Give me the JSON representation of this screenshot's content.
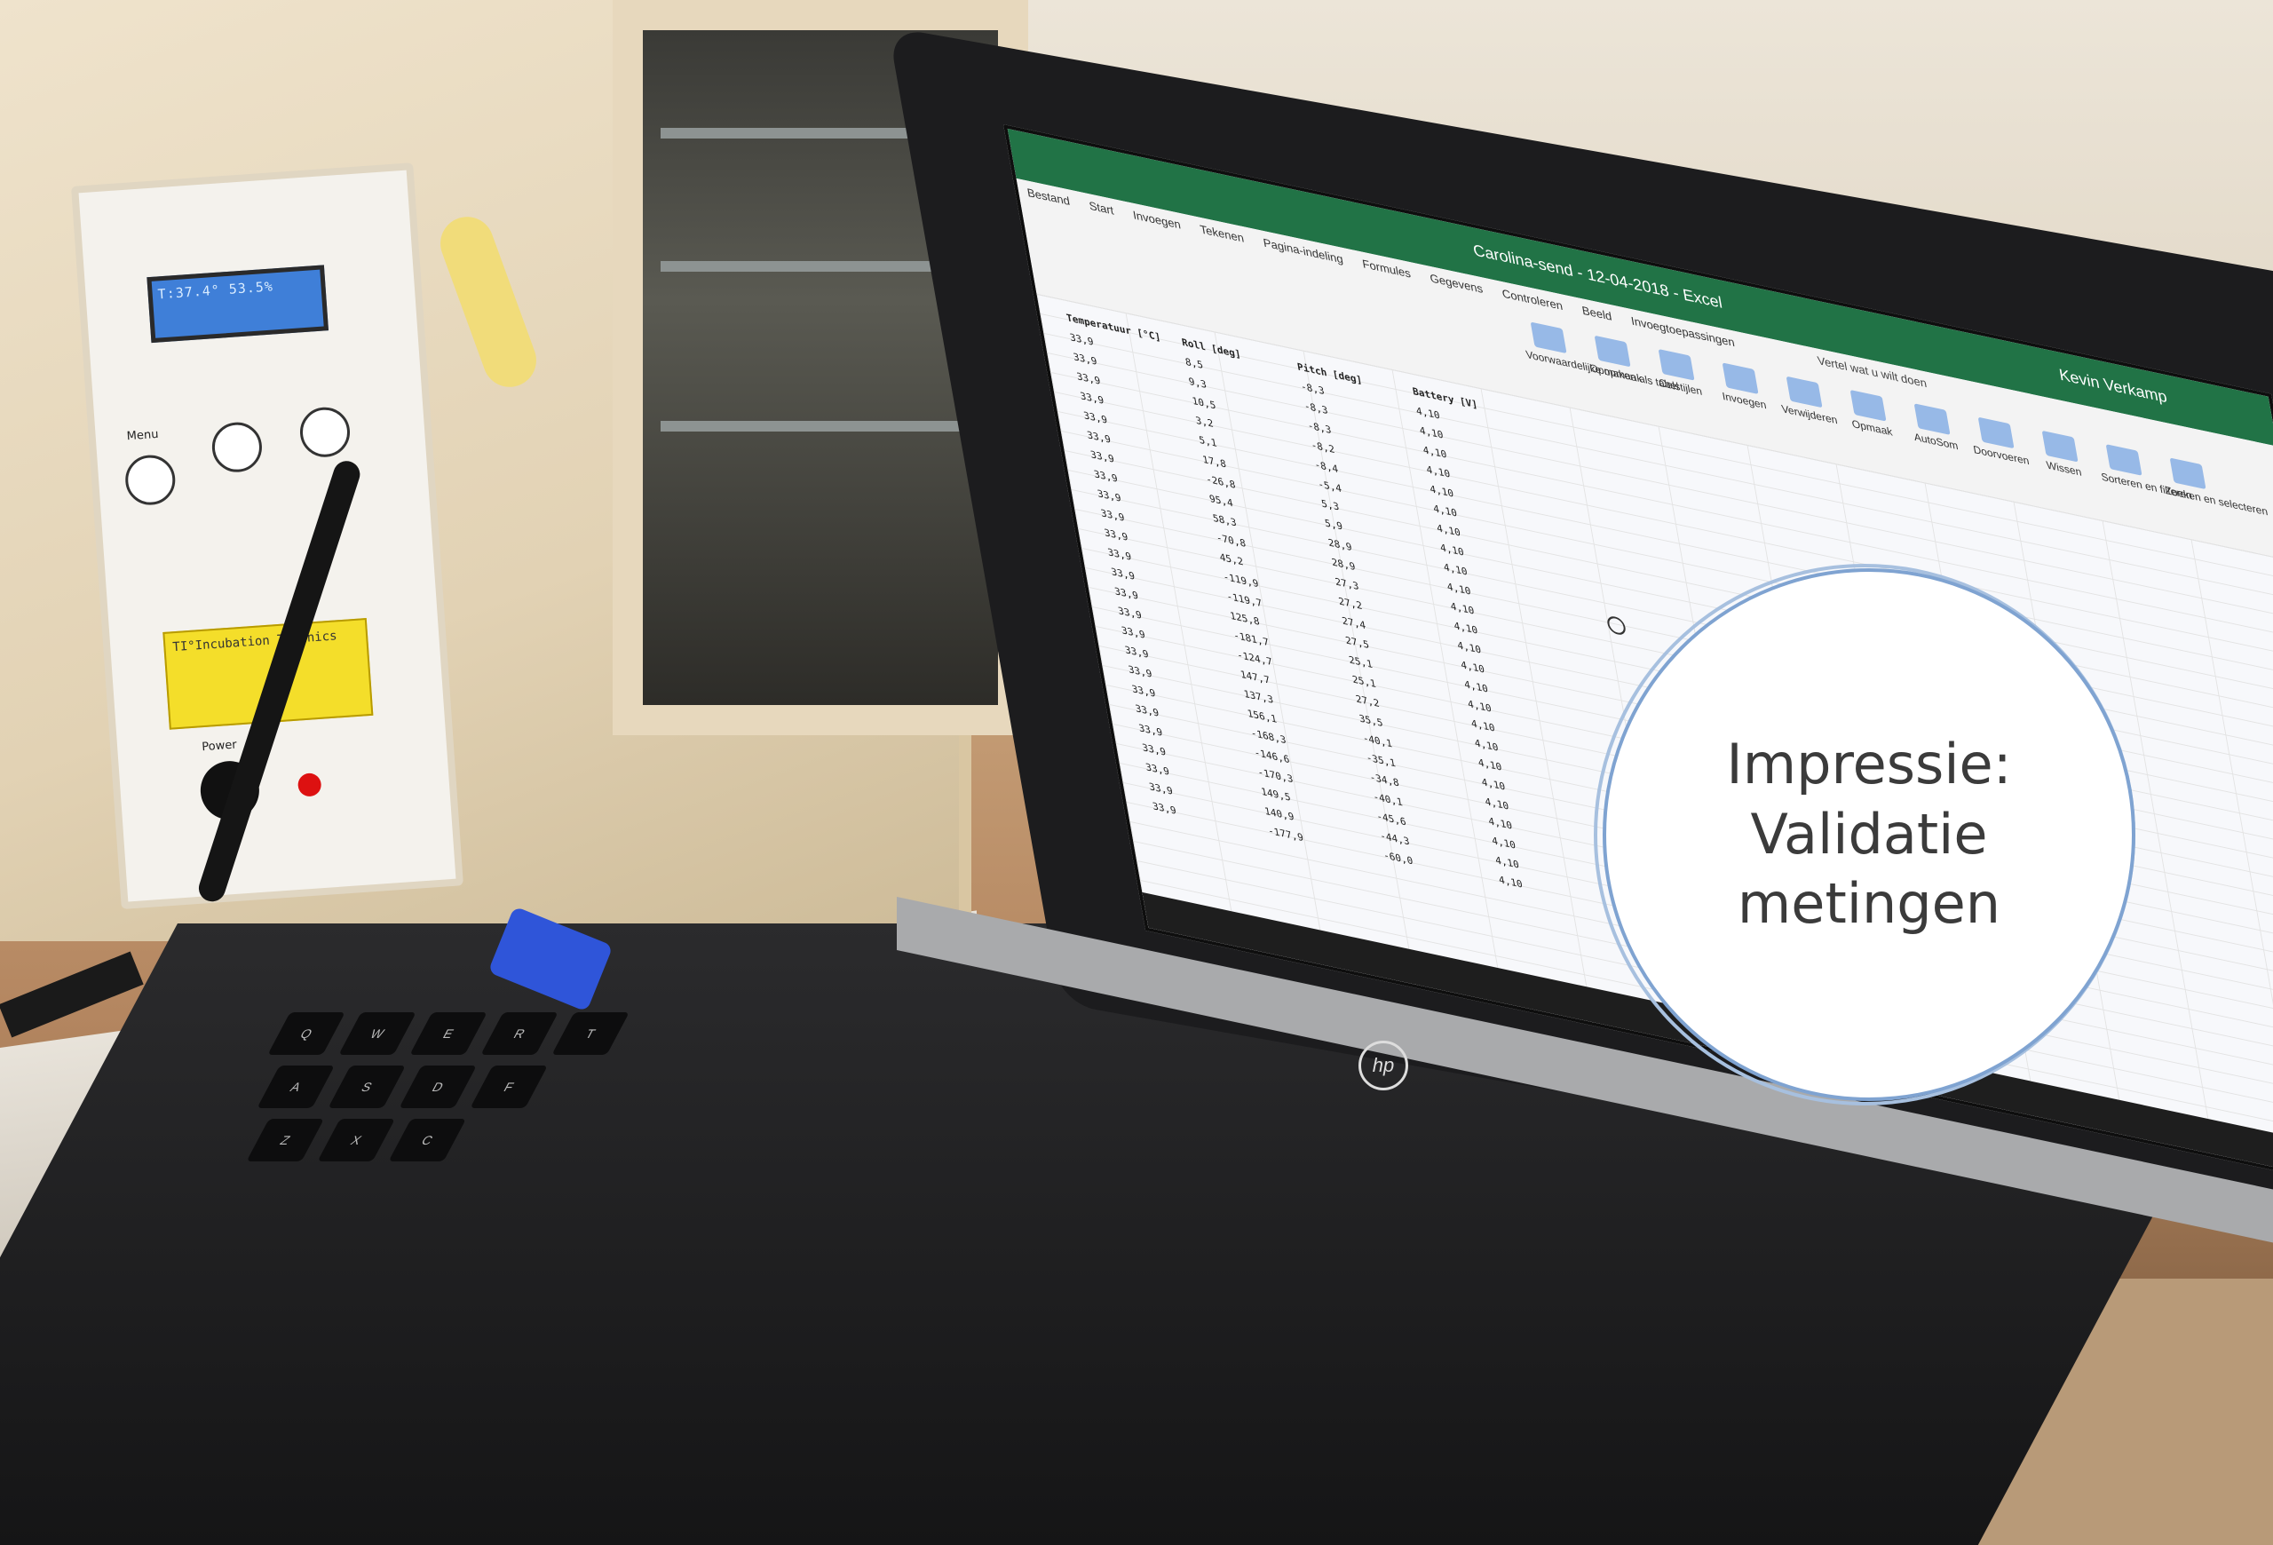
{
  "overlay": {
    "title_lines": [
      "Impressie:",
      "Validatie",
      "metingen"
    ],
    "ring_color": "#7fa3d1"
  },
  "incubator_panel": {
    "lcd_text": "T:37.4° 53.5%",
    "button_menu": "Menu",
    "sticker_text": "TI°Incubation Technics",
    "power_label": "Power"
  },
  "laptop": {
    "brand": "hp",
    "excel": {
      "window_title": "Carolina-send - 12-04-2018 - Excel",
      "user": "Kevin Verkamp",
      "tabs": [
        "Bestand",
        "Start",
        "Invoegen",
        "Tekenen",
        "Pagina-indeling",
        "Formules",
        "Gegevens",
        "Controleren",
        "Beeld",
        "Invoegtoepassingen"
      ],
      "tell_me": "Vertel wat u wilt doen",
      "ribbon_buttons": [
        "Voorwaardelijke opmaak",
        "Opmaken als tabel",
        "Celstijlen",
        "Invoegen",
        "Verwijderen",
        "Opmaak",
        "AutoSom",
        "Doorvoeren",
        "Wissen",
        "Sorteren en filteren",
        "Zoeken en selecteren"
      ],
      "columns": [
        "Temperatuur [°C]",
        "Roll [deg]",
        "Pitch [deg]",
        "Battery [V]"
      ],
      "rows": [
        [
          "33,9",
          "8,5",
          "-8,3",
          "4,10"
        ],
        [
          "33,9",
          "9,3",
          "-8,3",
          "4,10"
        ],
        [
          "33,9",
          "10,5",
          "-8,3",
          "4,10"
        ],
        [
          "33,9",
          "3,2",
          "-8,2",
          "4,10"
        ],
        [
          "33,9",
          "5,1",
          "-8,4",
          "4,10"
        ],
        [
          "33,9",
          "17,8",
          "-5,4",
          "4,10"
        ],
        [
          "33,9",
          "-26,8",
          "5,3",
          "4,10"
        ],
        [
          "33,9",
          "95,4",
          "5,9",
          "4,10"
        ],
        [
          "33,9",
          "58,3",
          "28,9",
          "4,10"
        ],
        [
          "33,9",
          "-70,8",
          "28,9",
          "4,10"
        ],
        [
          "33,9",
          "45,2",
          "27,3",
          "4,10"
        ],
        [
          "33,9",
          "-119,9",
          "27,2",
          "4,10"
        ],
        [
          "33,9",
          "-119,7",
          "27,4",
          "4,10"
        ],
        [
          "33,9",
          "125,8",
          "27,5",
          "4,10"
        ],
        [
          "33,9",
          "-181,7",
          "25,1",
          "4,10"
        ],
        [
          "33,9",
          "-124,7",
          "25,1",
          "4,10"
        ],
        [
          "33,9",
          "147,7",
          "27,2",
          "4,10"
        ],
        [
          "33,9",
          "137,3",
          "35,5",
          "4,10"
        ],
        [
          "33,9",
          "156,1",
          "-40,1",
          "4,10"
        ],
        [
          "33,9",
          "-168,3",
          "-35,1",
          "4,10"
        ],
        [
          "33,9",
          "-146,6",
          "-34,8",
          "4,10"
        ],
        [
          "33,9",
          "-170,3",
          "-40,1",
          "4,10"
        ],
        [
          "33,9",
          "149,5",
          "-45,6",
          "4,10"
        ],
        [
          "33,9",
          "140,9",
          "-44,3",
          "4,10"
        ],
        [
          "33,9",
          "-177,9",
          "-60,0",
          "4,10"
        ]
      ]
    },
    "keys": [
      "Q",
      "W",
      "E",
      "R",
      "T",
      "A",
      "S",
      "D",
      "F",
      "Z",
      "X",
      "C"
    ]
  }
}
